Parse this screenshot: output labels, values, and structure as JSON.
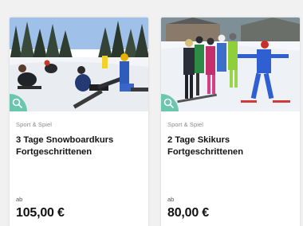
{
  "cards": [
    {
      "category": "Sport & Spiel",
      "title_line1": "3 Tage Snowboardkurs",
      "title_line2": "Fortgeschrittenen",
      "price_prefix": "ab",
      "price": "105,00 €",
      "image": "snowboard-group-photo",
      "badge_icon": "zoom-icon"
    },
    {
      "category": "Sport & Spiel",
      "title_line1": "2 Tage Skikurs",
      "title_line2": "Fortgeschrittenen",
      "price_prefix": "ab",
      "price": "80,00 €",
      "image": "ski-group-photo",
      "badge_icon": "zoom-icon"
    }
  ],
  "colors": {
    "badge": "#5cc3a6",
    "background": "#f1f1f1"
  }
}
